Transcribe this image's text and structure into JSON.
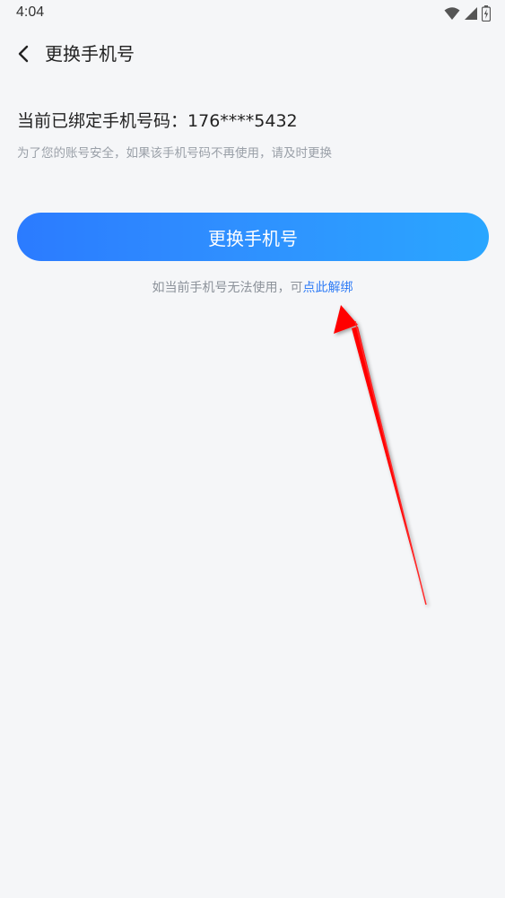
{
  "status_bar": {
    "time": "4:04"
  },
  "header": {
    "title": "更换手机号"
  },
  "main": {
    "current_phone_label": "当前已绑定手机号码：",
    "current_phone_value": "176****5432",
    "security_hint": "为了您的账号安全，如果该手机号码不再使用，请及时更换",
    "change_button_label": "更换手机号",
    "unbind_prefix": "如当前手机号无法使用，可",
    "unbind_link": "点此解绑"
  },
  "colors": {
    "accent": "#2f7cf6",
    "background": "#f5f6f8",
    "annotation_arrow": "#ff0000"
  }
}
